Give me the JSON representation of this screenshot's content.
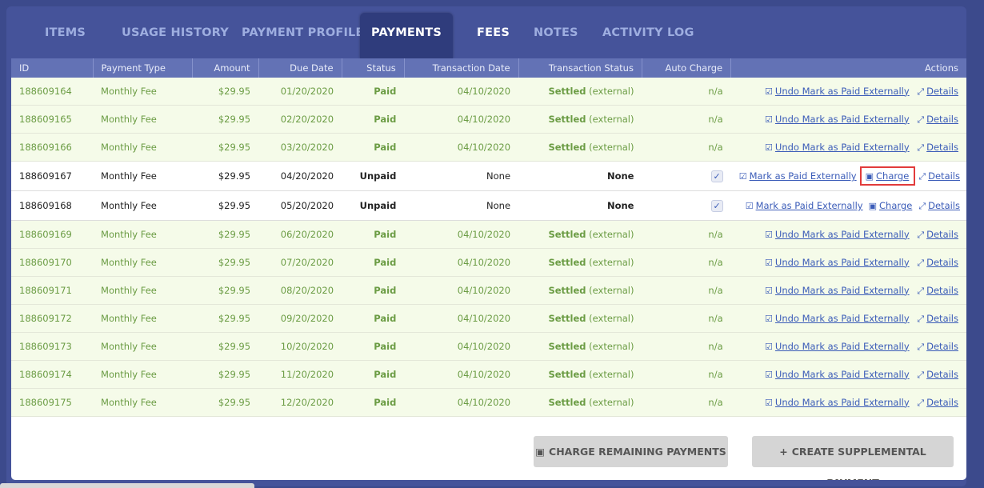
{
  "tabs": [
    {
      "label": "ITEMS"
    },
    {
      "label": "USAGE HISTORY"
    },
    {
      "label": "PAYMENT PROFILE"
    },
    {
      "label": "PAYMENTS"
    },
    {
      "label": "FEES"
    },
    {
      "label": "NOTES"
    },
    {
      "label": "ACTIVITY LOG"
    }
  ],
  "columns": {
    "id": "ID",
    "payment_type": "Payment Type",
    "amount": "Amount",
    "due_date": "Due Date",
    "status": "Status",
    "transaction_date": "Transaction Date",
    "transaction_status": "Transaction Status",
    "auto_charge": "Auto Charge",
    "actions": "Actions"
  },
  "actions": {
    "undo": "Undo Mark as Paid Externally",
    "mark": "Mark as Paid Externally",
    "charge": "Charge",
    "details": "Details"
  },
  "rows": [
    {
      "id": "188609164",
      "type": "Monthly Fee",
      "amount": "$29.95",
      "due": "01/20/2020",
      "status": "Paid",
      "tdate": "04/10/2020",
      "tstatus": "Settled",
      "tstatus_note": "(external)",
      "auto": "n/a"
    },
    {
      "id": "188609165",
      "type": "Monthly Fee",
      "amount": "$29.95",
      "due": "02/20/2020",
      "status": "Paid",
      "tdate": "04/10/2020",
      "tstatus": "Settled",
      "tstatus_note": "(external)",
      "auto": "n/a"
    },
    {
      "id": "188609166",
      "type": "Monthly Fee",
      "amount": "$29.95",
      "due": "03/20/2020",
      "status": "Paid",
      "tdate": "04/10/2020",
      "tstatus": "Settled",
      "tstatus_note": "(external)",
      "auto": "n/a"
    },
    {
      "id": "188609167",
      "type": "Monthly Fee",
      "amount": "$29.95",
      "due": "04/20/2020",
      "status": "Unpaid",
      "tdate": "None",
      "tstatus": "None",
      "tstatus_note": "",
      "auto": "checked"
    },
    {
      "id": "188609168",
      "type": "Monthly Fee",
      "amount": "$29.95",
      "due": "05/20/2020",
      "status": "Unpaid",
      "tdate": "None",
      "tstatus": "None",
      "tstatus_note": "",
      "auto": "checked"
    },
    {
      "id": "188609169",
      "type": "Monthly Fee",
      "amount": "$29.95",
      "due": "06/20/2020",
      "status": "Paid",
      "tdate": "04/10/2020",
      "tstatus": "Settled",
      "tstatus_note": "(external)",
      "auto": "n/a"
    },
    {
      "id": "188609170",
      "type": "Monthly Fee",
      "amount": "$29.95",
      "due": "07/20/2020",
      "status": "Paid",
      "tdate": "04/10/2020",
      "tstatus": "Settled",
      "tstatus_note": "(external)",
      "auto": "n/a"
    },
    {
      "id": "188609171",
      "type": "Monthly Fee",
      "amount": "$29.95",
      "due": "08/20/2020",
      "status": "Paid",
      "tdate": "04/10/2020",
      "tstatus": "Settled",
      "tstatus_note": "(external)",
      "auto": "n/a"
    },
    {
      "id": "188609172",
      "type": "Monthly Fee",
      "amount": "$29.95",
      "due": "09/20/2020",
      "status": "Paid",
      "tdate": "04/10/2020",
      "tstatus": "Settled",
      "tstatus_note": "(external)",
      "auto": "n/a"
    },
    {
      "id": "188609173",
      "type": "Monthly Fee",
      "amount": "$29.95",
      "due": "10/20/2020",
      "status": "Paid",
      "tdate": "04/10/2020",
      "tstatus": "Settled",
      "tstatus_note": "(external)",
      "auto": "n/a"
    },
    {
      "id": "188609174",
      "type": "Monthly Fee",
      "amount": "$29.95",
      "due": "11/20/2020",
      "status": "Paid",
      "tdate": "04/10/2020",
      "tstatus": "Settled",
      "tstatus_note": "(external)",
      "auto": "n/a"
    },
    {
      "id": "188609175",
      "type": "Monthly Fee",
      "amount": "$29.95",
      "due": "12/20/2020",
      "status": "Paid",
      "tdate": "04/10/2020",
      "tstatus": "Settled",
      "tstatus_note": "(external)",
      "auto": "n/a"
    }
  ],
  "buttons": {
    "charge_remaining": "CHARGE REMAINING PAYMENTS",
    "create_supplemental": "CREATE SUPPLEMENTAL PAYMENT"
  },
  "icons": {
    "check_square": "check-square-icon",
    "expand": "expand-icon",
    "cash": "cash-icon",
    "plus": "plus-icon"
  },
  "colors": {
    "accent": "#3b5cb8",
    "paid_text": "#6b9c44",
    "paid_row_bg": "#f5fbe9",
    "highlight": "#e23b3b"
  }
}
